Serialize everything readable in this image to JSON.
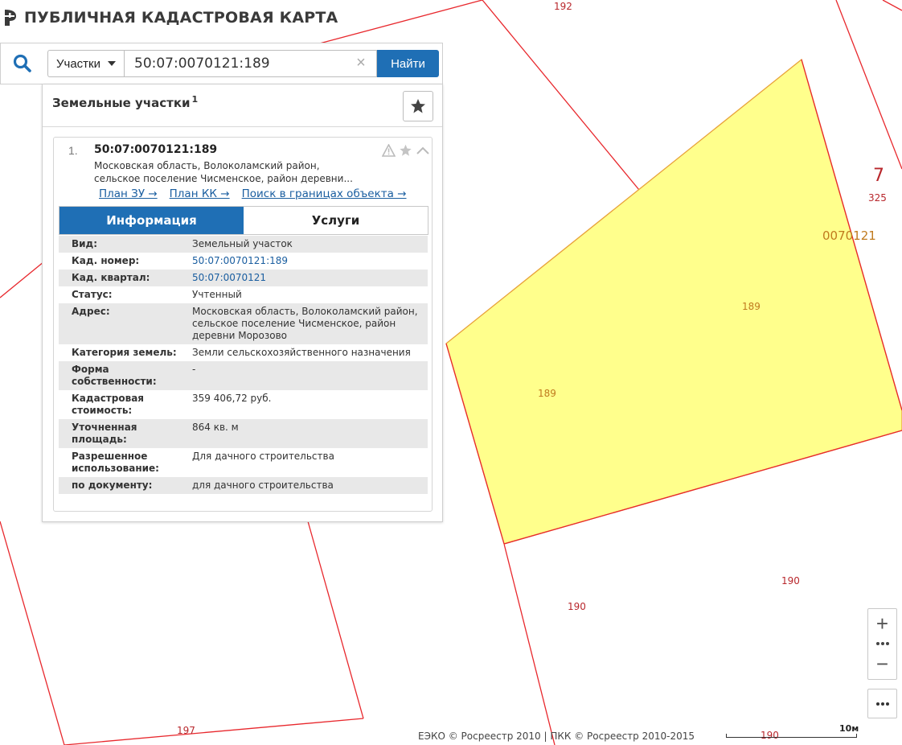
{
  "header": {
    "title": "ПУБЛИЧНАЯ КАДАСТРОВАЯ КАРТА"
  },
  "search": {
    "type_label": "Участки",
    "query": "50:07:0070121:189",
    "clear_glyph": "×",
    "find_label": "Найти"
  },
  "panel": {
    "title": "Земельные участки",
    "count": "1"
  },
  "result": {
    "index": "1.",
    "cad_number": "50:07:0070121:189",
    "address_short_line1": "Московская область, Волоколамский район,",
    "address_short_line2": "сельское поселение Чисменское, район деревни...",
    "links": [
      "План ЗУ →",
      "План КК →",
      "Поиск в границах объекта →"
    ],
    "tabs": [
      "Информация",
      "Услуги"
    ],
    "info": [
      {
        "key": "Вид:",
        "value": "Земельный участок"
      },
      {
        "key": "Кад. номер:",
        "value": "50:07:0070121:189"
      },
      {
        "key": "Кад. квартал:",
        "value": "50:07:0070121"
      },
      {
        "key": "Статус:",
        "value": "Учтенный"
      },
      {
        "key": "Адрес:",
        "value": "Московская область, Волоколамский район, сельское поселение Чисменское, район деревни Морозово"
      },
      {
        "key": "Категория земель:",
        "value": "Земли сельскохозяйственного назначения"
      },
      {
        "key": "Форма собственности:",
        "value": "-"
      },
      {
        "key": "Кадастровая стоимость:",
        "value": "359 406,72 руб."
      },
      {
        "key": "Уточненная площадь:",
        "value": "864 кв. м"
      },
      {
        "key": "Разрешенное использование:",
        "value": "Для дачного строительства"
      },
      {
        "key": "по документу:",
        "value": "для дачного строительства"
      }
    ]
  },
  "map": {
    "labels": {
      "p192": "192",
      "p7": "7",
      "p325": "325",
      "quarter": "0070121",
      "sel_a": "189",
      "sel_b": "189",
      "p190a": "190",
      "p190b": "190",
      "p190c": "190",
      "p197": "197"
    },
    "colors": {
      "border": "#e8282d",
      "selected_fill": "#ffff8c",
      "selected_border": "#e8a23a"
    }
  },
  "controls": {
    "zoom_in": "+",
    "zoom_out": "−",
    "more": "•••"
  },
  "footer": {
    "attribution": "ЕЭКО © Росреестр 2010 | ПКК © Росреестр 2010-2015",
    "scale": "10м"
  }
}
